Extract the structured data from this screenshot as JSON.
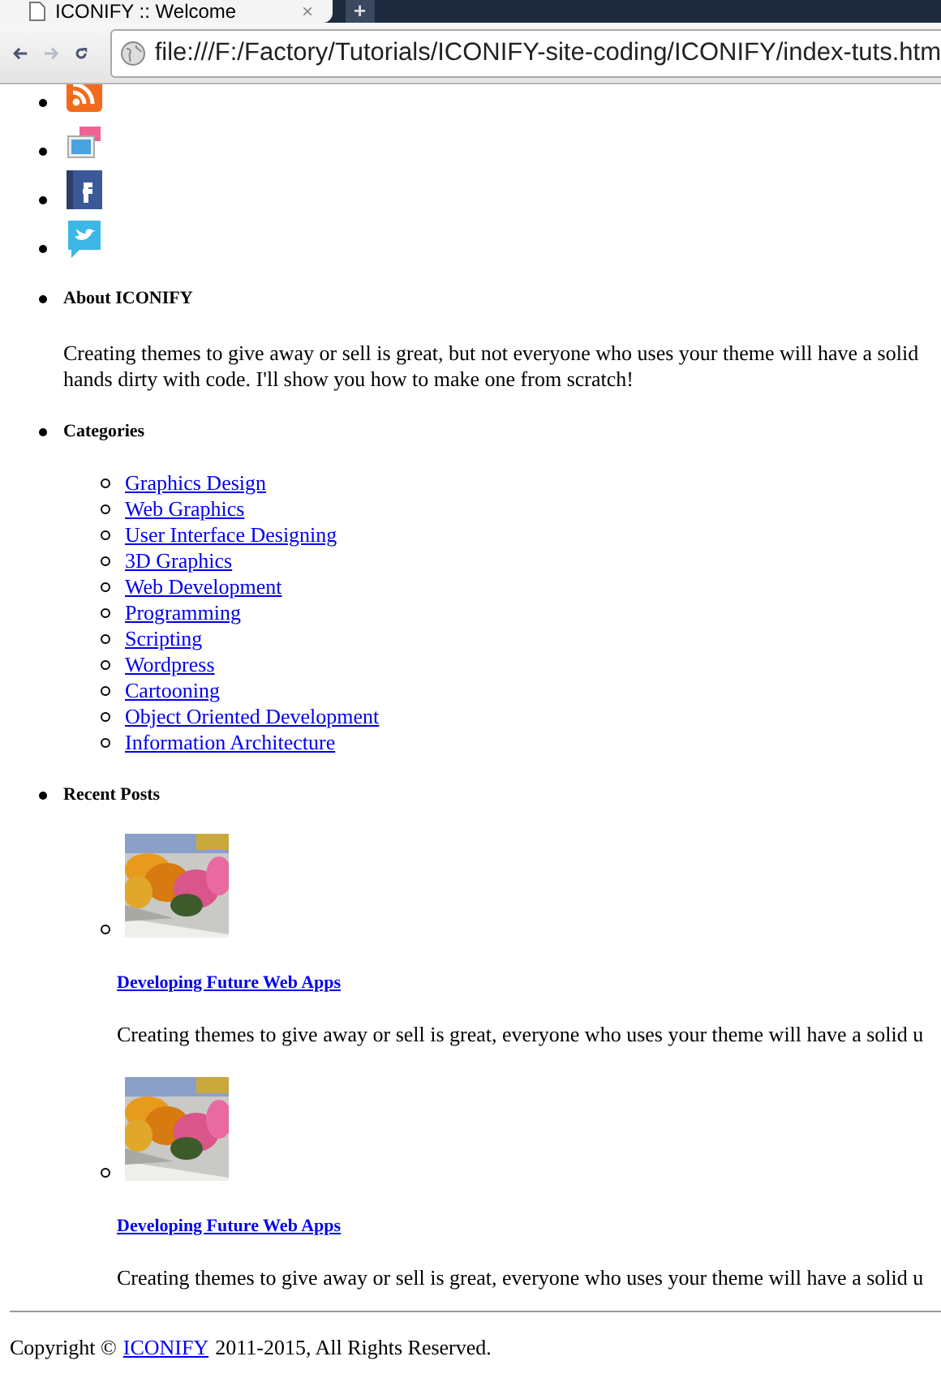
{
  "browser": {
    "tab_title": "ICONIFY :: Welcome",
    "close_tab": "×",
    "new_tab": "+",
    "address": "file:///F:/Factory/Tutorials/ICONIFY-site-coding/ICONIFY/index-tuts.htm"
  },
  "social_icons": [
    {
      "kind": "rss"
    },
    {
      "kind": "gallery"
    },
    {
      "kind": "facebook"
    },
    {
      "kind": "twitter"
    }
  ],
  "about": {
    "heading": "About ICONIFY",
    "lines": [
      "Creating themes to give away or sell is great, but not everyone who uses your theme will have a solid",
      "hands dirty with code. I'll show you how to make one from scratch!"
    ]
  },
  "categories": {
    "heading": "Categories",
    "items": [
      "Graphics Design",
      "Web Graphics",
      "User Interface Designing",
      "3D Graphics",
      "Web Development",
      "Programming",
      "Scripting",
      "Wordpress",
      "Cartooning",
      "Object Oriented Development",
      "Information Architecture"
    ]
  },
  "recent_posts": {
    "heading": "Recent Posts",
    "posts": [
      {
        "title": "Developing Future Web Apps",
        "excerpt": "Creating themes to give away or sell is great, everyone who uses your theme will have a solid u"
      },
      {
        "title": "Developing Future Web Apps",
        "excerpt": "Creating themes to give away or sell is great, everyone who uses your theme will have a solid u"
      }
    ]
  },
  "footer": {
    "prefix": "Copyright ©",
    "link": "ICONIFY",
    "suffix": "2011-2015, All Rights Reserved."
  }
}
